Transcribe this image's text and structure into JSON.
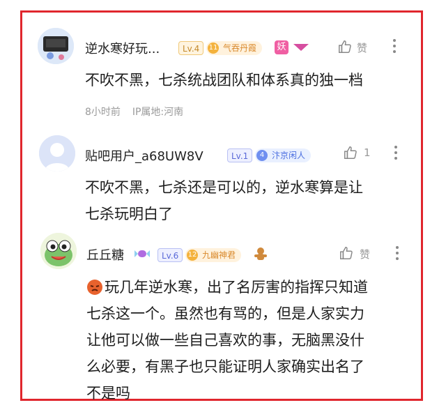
{
  "comments": [
    {
      "username": "逆水寒好玩...",
      "level": "Lv.4",
      "badge_num": "11",
      "badge_label": "气吞丹霞",
      "extra_badge": "妖",
      "like_label": "赞",
      "text_lines": [
        "不吹不黑，七杀统战团队和体系真的独一档"
      ],
      "time": "8小时前",
      "ip": "IP属地:河南"
    },
    {
      "username": "贴吧用户_a68UW8V",
      "level": "Lv.1",
      "badge_num": "4",
      "badge_label": "汴京闲人",
      "like_count": "1",
      "text_lines": [
        "不吹不黑，七杀还是可以的，逆水寒算是让",
        "七杀玩明白了"
      ]
    },
    {
      "username": "丘丘糖",
      "level": "Lv.6",
      "badge_num": "12",
      "badge_label": "九幽神君",
      "like_label": "赞",
      "text_lines": [
        "玩几年逆水寒，出了名厉害的指挥只知道",
        "七杀这一个。虽然也有骂的，但是人家实力",
        "让他可以做一些自己喜欢的事，无脑黑没什",
        "么必要，有黑子也只能证明人家确实出名了",
        "不是吗"
      ]
    }
  ],
  "colors": {
    "frame": "#e0262d",
    "level_gold": "#c48a2c",
    "level_blue": "#5a69d8",
    "meta": "#9a9a9a"
  }
}
